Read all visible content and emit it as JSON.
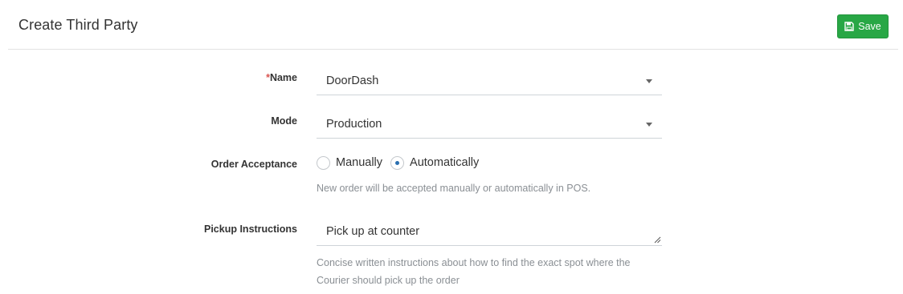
{
  "header": {
    "title": "Create Third Party",
    "save_label": "Save"
  },
  "form": {
    "name": {
      "required_mark": "*",
      "label": "Name",
      "value": "DoorDash"
    },
    "mode": {
      "label": "Mode",
      "value": "Production"
    },
    "order_acceptance": {
      "label": "Order Acceptance",
      "options": [
        {
          "label": "Manually",
          "checked": false
        },
        {
          "label": "Automatically",
          "checked": true
        }
      ],
      "help": "New order will be accepted manually or automatically in POS."
    },
    "pickup_instructions": {
      "label": "Pickup Instructions",
      "value": "Pick up at counter",
      "help_line1": "Concise written instructions about how to find the exact spot where the",
      "help_line2": "Courier should pick up the order"
    }
  },
  "icons": {
    "save": "floppy-disk-icon",
    "dropdown": "caret-down-icon",
    "resize": "resize-handle-icon"
  },
  "colors": {
    "save_button": "#28a745",
    "required": "#d9534f",
    "radio_dot": "#2a6fb0",
    "help_text": "#8a8f94"
  }
}
